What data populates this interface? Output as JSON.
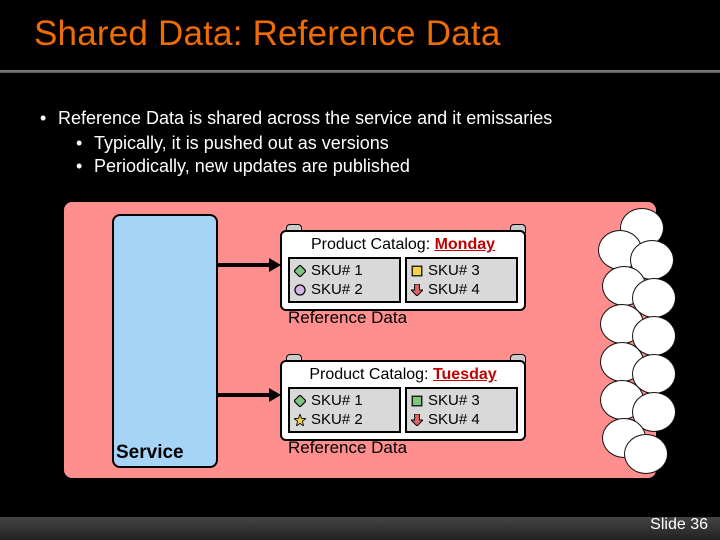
{
  "title": "Shared Data: Reference Data",
  "bullets": [
    "Reference Data is shared across the service and it emissaries",
    "Typically, it is pushed out as versions",
    "Periodically, new updates are published"
  ],
  "diagram": {
    "service_label": "Service",
    "catalog_prefix": "Product Catalog: ",
    "ref_label": "Reference Data",
    "catalogs": [
      {
        "day": "Monday",
        "skus": [
          "SKU# 1",
          "SKU# 2",
          "SKU# 3",
          "SKU# 4"
        ]
      },
      {
        "day": "Tuesday",
        "skus": [
          "SKU# 1",
          "SKU# 2",
          "SKU# 3",
          "SKU# 4"
        ]
      }
    ]
  },
  "footer": "Slide 36"
}
